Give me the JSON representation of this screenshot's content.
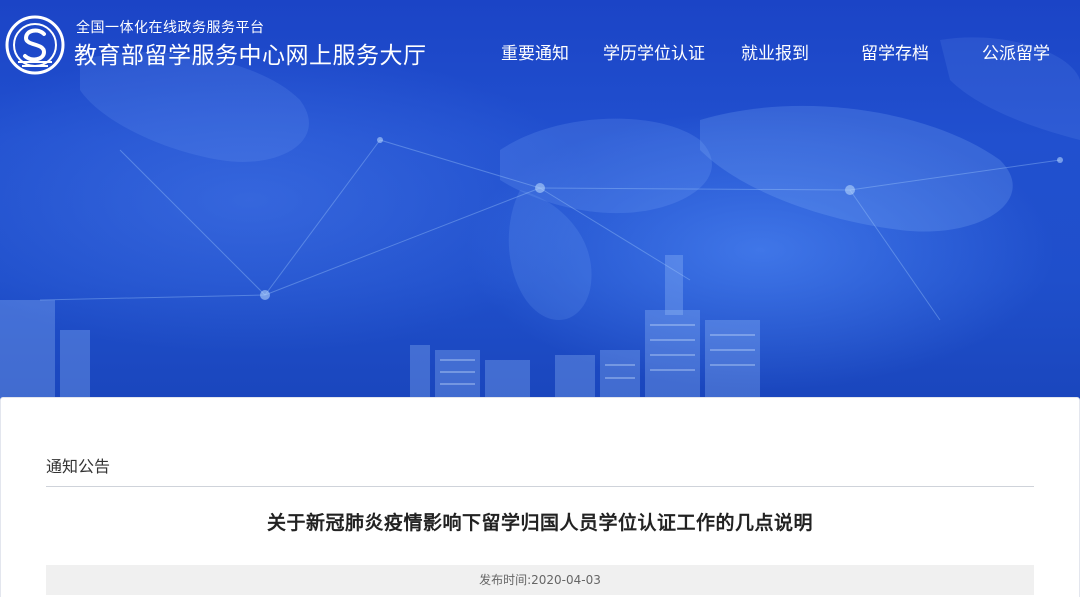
{
  "header": {
    "platform_subtitle": "全国一体化在线政务服务平台",
    "site_title": "教育部留学服务中心网上服务大厅"
  },
  "nav": {
    "items": [
      {
        "label": "重要通知"
      },
      {
        "label": "学历学位认证"
      },
      {
        "label": "就业报到"
      },
      {
        "label": "留学存档"
      },
      {
        "label": "公派留学"
      }
    ]
  },
  "content": {
    "section_label": "通知公告",
    "article_title": "关于新冠肺炎疫情影响下留学归国人员学位认证工作的几点说明",
    "publish_label": "发布时间:",
    "publish_date": "2020-04-03"
  },
  "colors": {
    "banner_blue": "#1f4fcb",
    "text_white": "#ffffff"
  }
}
